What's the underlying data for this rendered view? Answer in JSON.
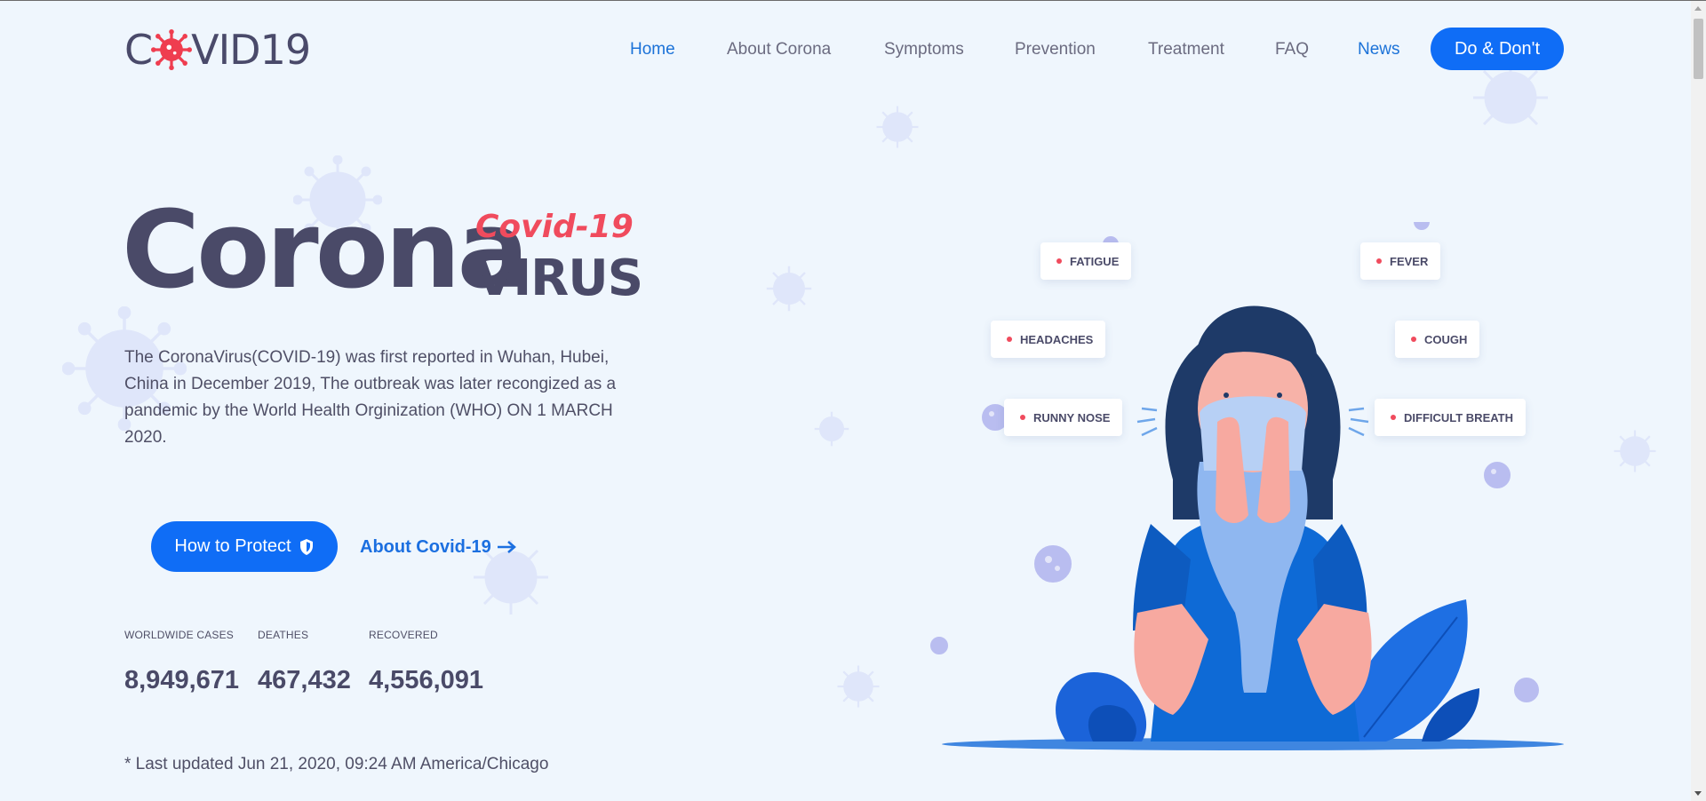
{
  "header": {
    "logo_before": "C",
    "logo_after": "VID19",
    "nav": [
      {
        "label": "Home",
        "active": true
      },
      {
        "label": "About Corona",
        "active": false
      },
      {
        "label": "Symptoms",
        "active": false
      },
      {
        "label": "Prevention",
        "active": false
      },
      {
        "label": "Treatment",
        "active": false
      },
      {
        "label": "FAQ",
        "active": false
      },
      {
        "label": "News",
        "active": true
      }
    ],
    "cta_label": "Do & Don't"
  },
  "hero": {
    "title_main": "Corona",
    "title_accent": "Covid-19",
    "title_sub": "VIRUS",
    "description": "The CoronaVirus(COVID-19) was first reported in Wuhan, Hubei, China in December 2019, The outbreak was later recongized as a pandemic by the World Health Orginization (WHO) ON 1 MARCH 2020.",
    "primary_button": "How to Protect",
    "primary_button_icon": "shield-icon",
    "secondary_link": "About Covid-19",
    "secondary_link_icon": "arrow-right-icon"
  },
  "stats": [
    {
      "label": "WORLDWIDE CASES",
      "value": "8,949,671"
    },
    {
      "label": "DEATHES",
      "value": "467,432"
    },
    {
      "label": "RECOVERED",
      "value": "4,556,091"
    }
  ],
  "last_updated": "* Last updated Jun 21, 2020, 09:24 AM America/Chicago",
  "symptoms": [
    "FATIGUE",
    "HEADACHES",
    "RUNNY NOSE",
    "FEVER",
    "COUGH",
    "DIFFICULT BREATH"
  ],
  "colors": {
    "background": "#eff6fd",
    "primary": "#0f6df6",
    "accent_red": "#f04b5d",
    "text_dark": "#4a4a68",
    "nav_active": "#1b72d8"
  }
}
